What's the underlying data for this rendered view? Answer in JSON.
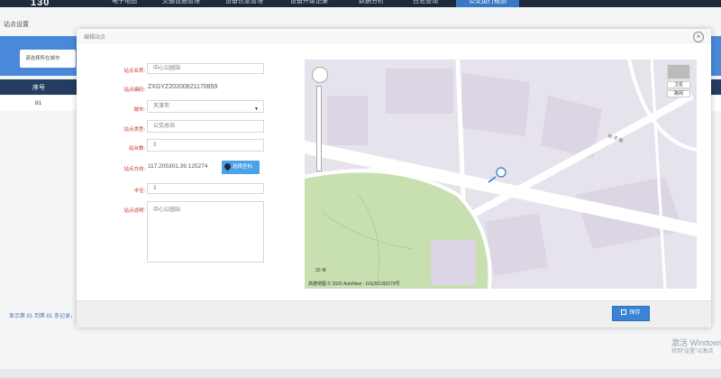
{
  "topnav": {
    "items": [
      {
        "label": "电子地图"
      },
      {
        "label": "交通设施管理"
      },
      {
        "label": "设备信息管理"
      },
      {
        "label": "设备升级记录"
      },
      {
        "label": "数据分析"
      },
      {
        "label": "日志查询"
      },
      {
        "label": "公交运行规划"
      }
    ],
    "active_index": 6,
    "active_color": "#3a78c4"
  },
  "background": {
    "title": "站点设置",
    "city_select_placeholder": "请选择所在城市",
    "table_header_num": "序号",
    "row_num": "81",
    "pager_text": "显示第 81 到第 81 条记录，",
    "watermark_line1": "激活 Windows",
    "watermark_line2": "转到\"设置\"以激活"
  },
  "modal": {
    "title": "编辑站点",
    "fields": {
      "name_label": "站点名称:",
      "name_value": "中心公园站",
      "code_label": "站点编码:",
      "code_value": "ZXGYZ20200821170859",
      "city_label": "城市:",
      "city_value": "天津市",
      "type_label": "站点类型:",
      "type_value": "公交总站",
      "platforms_label": "站台数:",
      "platforms_value": "3",
      "location_label": "站点方向:",
      "location_value": "117.205301,39.125274",
      "pick_coord_button": "选择坐标",
      "radius_label": "半径:",
      "radius_value": "3",
      "desc_label": "站点说明:",
      "desc_value": "中心公园站"
    },
    "save_button": "保存",
    "close_icon": "×"
  },
  "map": {
    "layer_satellite": "卫星",
    "layer_roadnet": "路网",
    "scale": "20 米",
    "copyright": "高德地图 © 2020 AutoNavi - GS(2019)6379号",
    "road_label": "和 平 路",
    "colors": {
      "base": "#e7e3ec",
      "park": "#c8dfb0",
      "road": "#ffffff",
      "block": "#dcd5e3"
    }
  }
}
